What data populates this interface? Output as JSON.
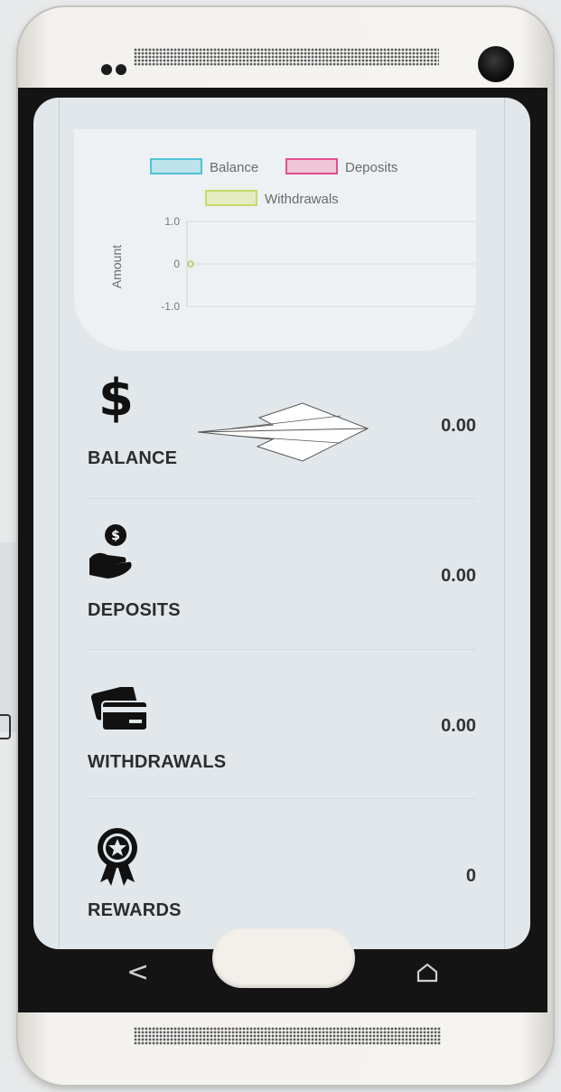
{
  "chart": {
    "legend": [
      "Balance",
      "Deposits",
      "Withdrawals"
    ],
    "ylabel": "Amount",
    "yticks": [
      "1.0",
      "0",
      "-1.0"
    ],
    "legend_colors": {
      "Balance": "#4fc3d9",
      "Deposits": "#e04f8f",
      "Withdrawals": "#c9d96a"
    }
  },
  "chart_data": {
    "type": "line",
    "series": [
      {
        "name": "Balance",
        "values": [
          0
        ]
      },
      {
        "name": "Deposits",
        "values": [
          0
        ]
      },
      {
        "name": "Withdrawals",
        "values": [
          0
        ]
      }
    ],
    "ylabel": "Amount",
    "ylim": [
      -1.0,
      1.0
    ],
    "yticks": [
      1.0,
      0,
      -1.0
    ],
    "legend": "top",
    "grid": true
  },
  "items": [
    {
      "label": "BALANCE",
      "value": "0.00",
      "icon": "dollar-icon"
    },
    {
      "label": "DEPOSITS",
      "value": "0.00",
      "icon": "deposit-hand-icon"
    },
    {
      "label": "WITHDRAWALS",
      "value": "0.00",
      "icon": "cards-icon"
    },
    {
      "label": "REWARDS",
      "value": "0",
      "icon": "award-ribbon-icon"
    }
  ],
  "nav": {
    "back": "back-icon",
    "home": "home-icon"
  }
}
